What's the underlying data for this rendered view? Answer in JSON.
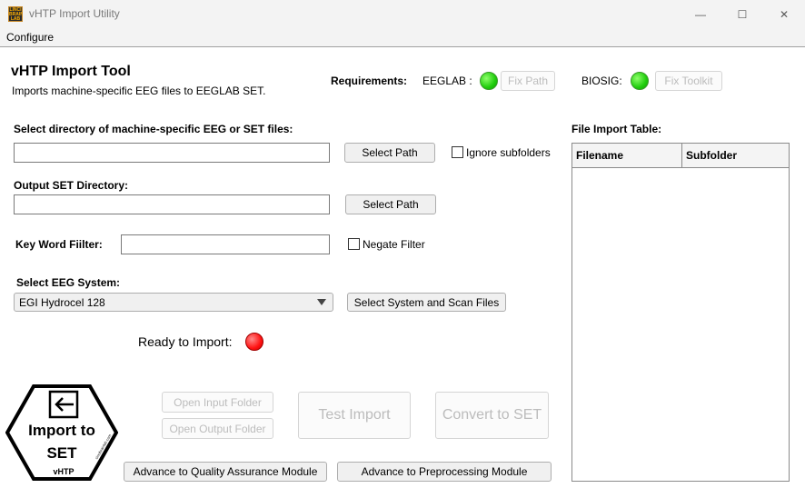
{
  "window": {
    "app_icon_text": "LINCI BRAIN LAB",
    "title": "vHTP Import Utility",
    "minimize": "—",
    "maximize": "☐",
    "close": "✕"
  },
  "menu": {
    "configure": "Configure"
  },
  "header": {
    "title": "vHTP Import Tool",
    "subtitle": "Imports machine-specific EEG files to EEGLAB SET."
  },
  "requirements": {
    "label": "Requirements:",
    "eeglab_label": "EEGLAB :",
    "eeglab_fix": "Fix Path",
    "biosig_label": "BIOSIG:",
    "biosig_fix": "Fix Toolkit",
    "eeglab_status_color": "#1fcc0c",
    "biosig_status_color": "#1fcc0c"
  },
  "input_dir": {
    "label": "Select directory of machine-specific EEG or SET files:",
    "value": "",
    "select_path": "Select Path",
    "ignore_subfolders_label": "Ignore subfolders",
    "ignore_subfolders_checked": false
  },
  "output_dir": {
    "label": "Output SET Directory:",
    "value": "",
    "select_path": "Select Path"
  },
  "keyword": {
    "label": "Key Word Fiilter:",
    "value": "",
    "negate_label": "Negate Filter",
    "negate_checked": false
  },
  "eeg_system": {
    "label": "Select EEG System:",
    "selected": "EGI Hydrocel 128",
    "scan_button": "Select System and Scan Files"
  },
  "ready": {
    "label": "Ready to Import:",
    "status_color": "#ff1212"
  },
  "actions": {
    "open_input": "Open Input Folder",
    "open_output": "Open Output Folder",
    "test_import": "Test Import",
    "convert": "Convert to SET",
    "advance_qa": "Advance to Quality Assurance Module",
    "advance_pre": "Advance to Preprocessing Module"
  },
  "logo": {
    "line1": "Import to",
    "line2": "SET",
    "footer": "vHTP",
    "side": "cincibrainlab.com"
  },
  "file_table": {
    "label": "File Import Table:",
    "columns": [
      "Filename",
      "Subfolder"
    ],
    "rows": []
  }
}
